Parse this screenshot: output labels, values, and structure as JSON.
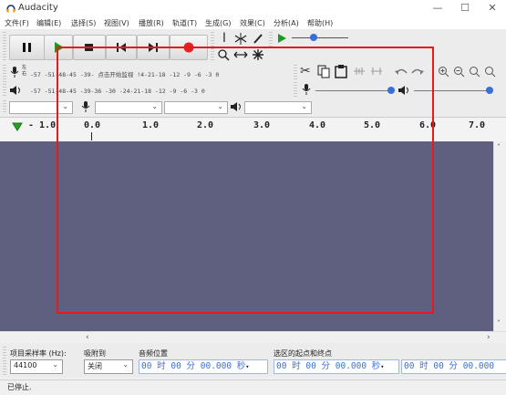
{
  "window": {
    "title": "Audacity",
    "minimize": "—",
    "maximize": "☐",
    "close": "✕"
  },
  "menu": [
    "文件(F)",
    "编辑(E)",
    "选择(S)",
    "视图(V)",
    "播放(R)",
    "轨道(T)",
    "生成(G)",
    "效果(C)",
    "分析(A)",
    "帮助(H)"
  ],
  "meters": {
    "rec_scale": "-57  -51-48-45  -39-  点击开始监视  !4-21-18  -12 -9 -6 -3 0",
    "play_scale": "-57  -51-48-45  -39-36  -30  -24-21-18  -12 -9 -6 -3 0",
    "rec_label_l": "左",
    "rec_label_r": "右"
  },
  "ruler": {
    "labels": [
      "- 1.0",
      "0.0",
      "1.0",
      "2.0",
      "3.0",
      "4.0",
      "5.0",
      "6.0",
      "7.0"
    ]
  },
  "selection_bar": {
    "rate_label": "项目采样率 (Hz):",
    "rate_value": "44100",
    "snap_label": "吸附到",
    "snap_value": "关闭",
    "audio_pos_label": "音频位置",
    "audio_pos_value": "00 时 00 分 00.000 秒",
    "range_label": "选区的起点和终点",
    "range_start": "00 时 00 分 00.000 秒",
    "range_end": "00 时 00 分 00.000"
  },
  "status": {
    "text": "已停止."
  },
  "colors": {
    "track_background": "#5f5f7f",
    "highlight_box": "#e51b1b",
    "time_text": "#3a6fd8"
  }
}
